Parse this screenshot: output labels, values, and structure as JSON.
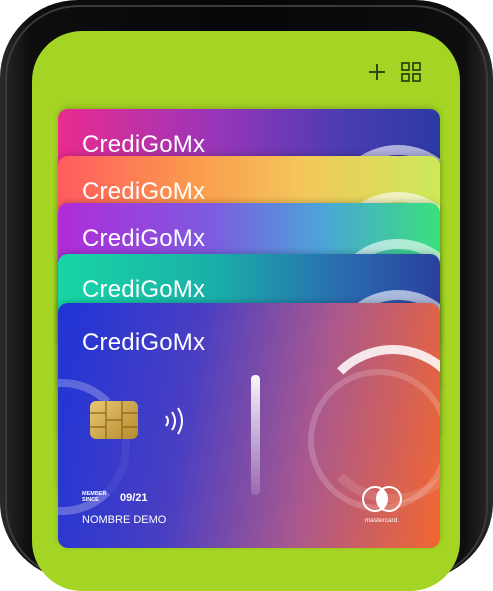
{
  "toolbar": {
    "add_icon": "plus-icon",
    "grid_icon": "grid-icon"
  },
  "colors": {
    "screen": "#a4d424",
    "phone": "#0a0a0a"
  },
  "cards": [
    {
      "brand": "CrediGoMx"
    },
    {
      "brand": "CrediGoMx"
    },
    {
      "brand": "CrediGoMx"
    },
    {
      "brand": "CrediGoMx"
    },
    {
      "brand": "CrediGoMx",
      "member_since_label": "MEMBER SINCE",
      "expiry": "09/21",
      "holder_name": "NOMBRE DEMO",
      "network": "mastercard."
    }
  ]
}
